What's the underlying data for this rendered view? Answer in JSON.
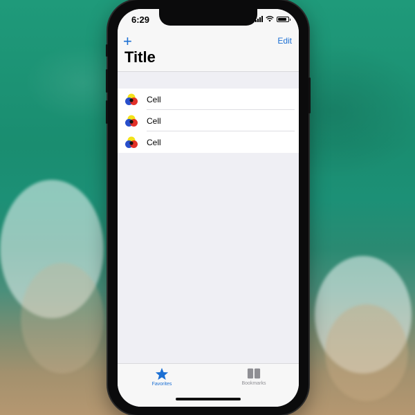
{
  "status_bar": {
    "time": "6:29",
    "icons": [
      "cellular-signal-icon",
      "wifi-icon",
      "battery-icon"
    ],
    "battery_level": 0.85
  },
  "nav_bar": {
    "add_label": "+",
    "edit_label": "Edit",
    "title": "Title"
  },
  "list": {
    "items": [
      {
        "label": "Cell",
        "icon": "color-circles-icon"
      },
      {
        "label": "Cell",
        "icon": "color-circles-icon"
      },
      {
        "label": "Cell",
        "icon": "color-circles-icon"
      }
    ]
  },
  "tab_bar": {
    "tabs": [
      {
        "label": "Favorites",
        "icon": "star-icon",
        "selected": true
      },
      {
        "label": "Bookmarks",
        "icon": "book-icon",
        "selected": false
      }
    ]
  },
  "colors": {
    "accent": "#1b6fd3",
    "background": "#efeff4",
    "bar": "#f7f7f7",
    "inactive_tab": "#8e8e93"
  }
}
